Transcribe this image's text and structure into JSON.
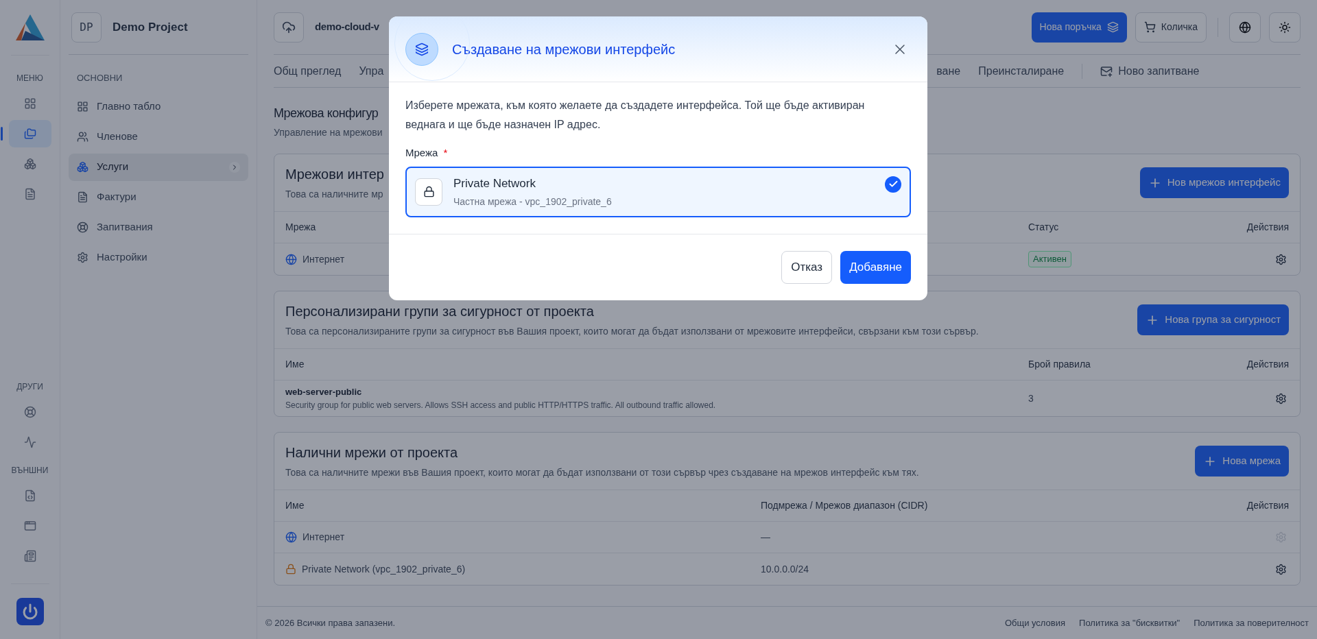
{
  "rail": {
    "sections": [
      {
        "label": "МЕНЮ",
        "items": [
          {
            "selected": false
          },
          {
            "selected": true
          },
          {
            "selected": false
          },
          {
            "selected": false
          }
        ]
      },
      {
        "label": "ДРУГИ",
        "items": [
          {
            "selected": false
          },
          {
            "selected": false
          }
        ]
      },
      {
        "label": "ВЪНШНИ",
        "items": [
          {
            "selected": false
          },
          {
            "selected": false
          },
          {
            "selected": false
          }
        ]
      }
    ]
  },
  "project": {
    "initials": "DP",
    "name": "Demo Project"
  },
  "sidebar": {
    "section": "ОСНОВНИ",
    "items": [
      {
        "label": "Главно табло",
        "selected": false
      },
      {
        "label": "Членове",
        "selected": false
      },
      {
        "label": "Услуги",
        "selected": true
      },
      {
        "label": "Фактури",
        "selected": false
      },
      {
        "label": "Запитвания",
        "selected": false
      },
      {
        "label": "Настройки",
        "selected": false
      }
    ]
  },
  "topbar": {
    "server": "demo-cloud-v",
    "buttons": [
      {
        "label": "Нова поръчка",
        "kind": "primary"
      },
      {
        "label": "Количка",
        "kind": "outline"
      }
    ]
  },
  "tabs": [
    {
      "label": "Общ преглед"
    },
    {
      "label": "Упра"
    },
    {
      "label": "ване"
    },
    {
      "label": "Преинсталиране"
    },
    {
      "label": "Ново запитване",
      "kind": "request"
    }
  ],
  "page": {
    "title": "Мрежова конфигур",
    "subtitle": "Управление на мрежови"
  },
  "cards": [
    {
      "title": "Мрежови интер",
      "description": "Това са наличните мр",
      "button": "Нов мрежов интерфейс",
      "columns": [
        "Мрежа",
        "Статус",
        "Действия"
      ],
      "rows": [
        {
          "kind": "internet",
          "name": "Интернет",
          "cell_2": "Активен",
          "disabled": false
        }
      ]
    },
    {
      "title": "Персонализирани групи за сигурност от проекта",
      "description": "Това са персонализираните групи за сигурност във Вашия проект, които могат да бъдат използвани от мрежовите интерфейси, свързани към този сървър.",
      "button": "Нова група за сигурност",
      "columns": [
        "Име",
        "Брой правила",
        "Действия"
      ],
      "rows": [
        {
          "kind": "group",
          "name": "web-server-public",
          "note": "Security group for public web servers. Allows SSH access and public HTTP/HTTPS traffic. All outbound traffic allowed.",
          "cell_2": "3",
          "disabled": false
        }
      ]
    },
    {
      "title": "Налични мрежи от проекта",
      "description": "Това са наличните мрежи във Вашия проект, които могат да бъдат използвани от този сървър чрез създаване на мрежов интерфейс към тях.",
      "button": "Нова мрежа",
      "columns": [
        "Име",
        "Подмрежа / Мрежов диапазон (CIDR)",
        "Действия"
      ],
      "rows": [
        {
          "kind": "internet",
          "name": "Интернет",
          "cell_2": "—",
          "disabled": true
        },
        {
          "kind": "private",
          "name": "Private Network (vpc_1902_private_6)",
          "cell_2": "10.0.0.0/24",
          "disabled": false
        }
      ]
    }
  ],
  "footer": {
    "copyright": "© 2026 Всички права запазени.",
    "links": [
      "Общи условия",
      "Политика за \"бисквитки\"",
      "Политика за поверителност"
    ]
  },
  "modal": {
    "title": "Създаване на мрежови интерфейс",
    "text": "Изберете мрежата, към която желаете да създадете интерфейса. Той ще бъде активиран веднага и ще бъде назначен IP адрес.",
    "field_label": "Мрежа",
    "required_mark": "*",
    "options": [
      {
        "title": "Private Network",
        "subtitle": "Частна мрежа - vpc_1902_private_6",
        "selected": true
      }
    ],
    "buttons": [
      {
        "label": "Отказ",
        "kind": "secondary"
      },
      {
        "label": "Добавяне",
        "kind": "primary"
      }
    ]
  }
}
